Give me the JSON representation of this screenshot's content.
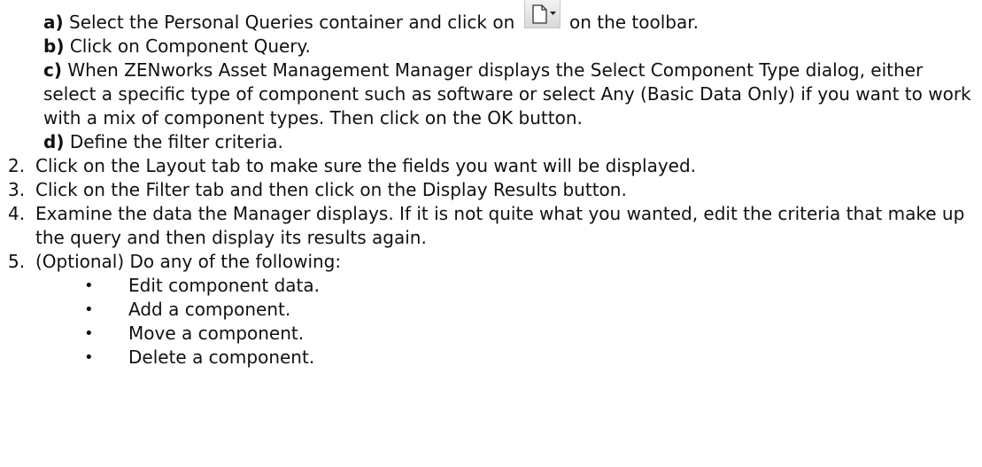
{
  "substeps": [
    {
      "marker": "a)",
      "text_before": " Select the Personal Queries container and click on ",
      "text_after": " on the toolbar."
    },
    {
      "marker": "b)",
      "text": " Click on Component Query."
    },
    {
      "marker": "c)",
      "text": " When ZENworks Asset Management Manager displays the Select Component Type dialog, either select a specific type of component such as software or select Any (Basic Data Only) if you want to work with a mix of component types. Then click on the OK button."
    },
    {
      "marker": "d)",
      "text": " Define the filter criteria."
    }
  ],
  "toolbar_icon": "new-document-dropdown-icon",
  "steps": [
    {
      "number": "2.",
      "text": "Click on the Layout tab to make sure the fields you want will be displayed."
    },
    {
      "number": "3.",
      "text": "Click on the Filter tab and then click on the Display Results button."
    },
    {
      "number": "4.",
      "text": "Examine the data the Manager displays. If it is not quite what you wanted, edit the criteria that make up the query and then display its results again."
    },
    {
      "number": "5.",
      "text": "(Optional) Do any of the following:"
    }
  ],
  "bullets": [
    "Edit component data.",
    "Add a component.",
    "Move a component.",
    "Delete a component."
  ],
  "bullet_char": "•"
}
